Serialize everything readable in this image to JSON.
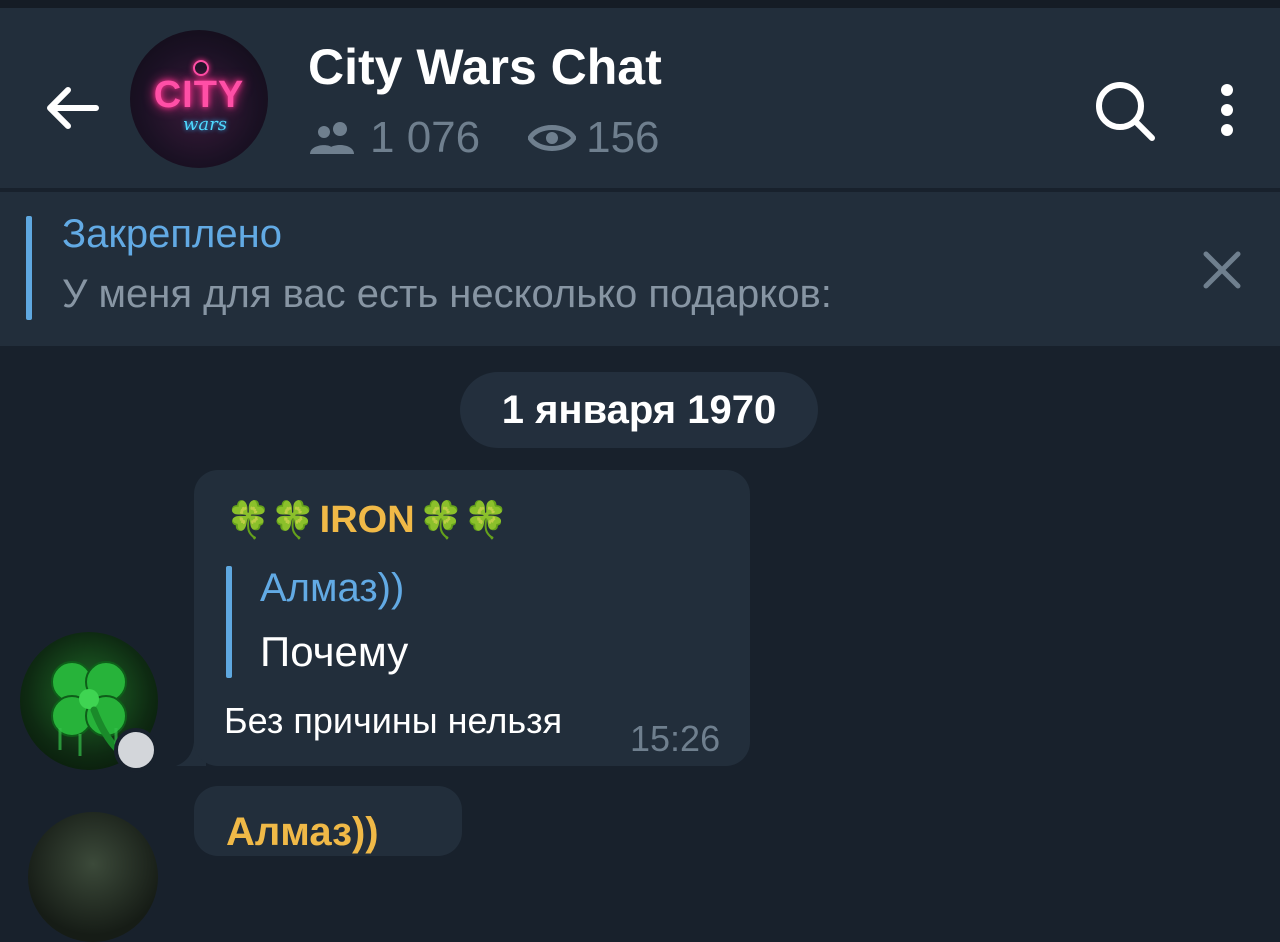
{
  "header": {
    "title": "City Wars Chat",
    "avatar_logo_line1": "CITY",
    "avatar_logo_line2": "wars",
    "members_count": "1 076",
    "online_count": "156"
  },
  "pinned": {
    "label": "Закреплено",
    "text": "У меня для вас есть несколько подарков:"
  },
  "date_separator": "1 января 1970",
  "messages": [
    {
      "sender_name": "IRON",
      "sender_decoration": "🍀🍀",
      "reply_author": "Алмаз))",
      "reply_text": "Почему",
      "text": "Без причины нельзя",
      "time": "15:26"
    },
    {
      "sender_name": "Алмаз))"
    }
  ],
  "colors": {
    "background": "#18212c",
    "header": "#222e3b",
    "accent": "#62aae4",
    "sender_name": "#f0b947",
    "muted": "#6f7f8e"
  },
  "icons": [
    "back-arrow-icon",
    "members-icon",
    "eye-icon",
    "search-icon",
    "more-vertical-icon",
    "close-icon",
    "clover-icon"
  ]
}
